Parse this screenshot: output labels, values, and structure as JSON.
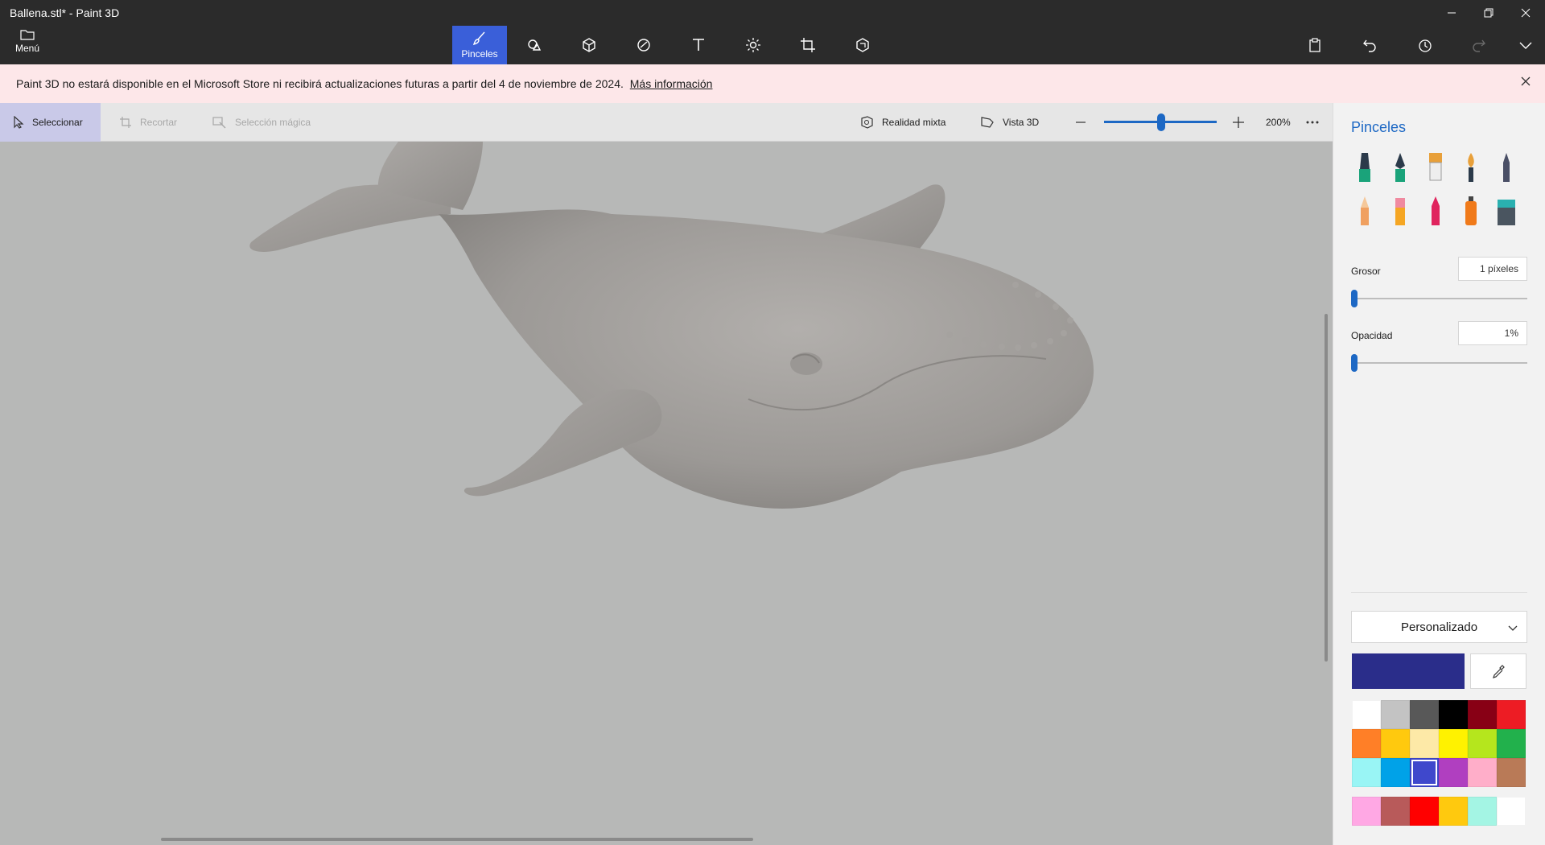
{
  "window": {
    "title": "Ballena.stl* - Paint 3D",
    "menu_label": "Menú"
  },
  "tools": [
    {
      "name": "brushes",
      "label": "Pinceles",
      "icon": "brush-icon",
      "active": true
    },
    {
      "name": "shapes-2d",
      "label": "",
      "icon": "2d-shapes-icon"
    },
    {
      "name": "shapes-3d",
      "label": "",
      "icon": "3d-shapes-icon"
    },
    {
      "name": "stickers",
      "label": "",
      "icon": "stickers-icon"
    },
    {
      "name": "text",
      "label": "",
      "icon": "text-icon"
    },
    {
      "name": "effects",
      "label": "",
      "icon": "effects-icon"
    },
    {
      "name": "canvas",
      "label": "",
      "icon": "canvas-icon"
    },
    {
      "name": "3d-library",
      "label": "",
      "icon": "3d-library-icon"
    }
  ],
  "banner": {
    "text": "Paint 3D no estará disponible en el Microsoft Store ni recibirá actualizaciones futuras a partir del 4 de noviembre de 2024.",
    "link": "Más información"
  },
  "canvas_toolbar": {
    "select": "Seleccionar",
    "crop": "Recortar",
    "magic_select": "Selección mágica",
    "mixed_reality": "Realidad mixta",
    "view3d": "Vista 3D",
    "zoom": "200%"
  },
  "panel": {
    "title": "Pinceles",
    "brushes": [
      {
        "name": "marker",
        "color": "#1aa37a"
      },
      {
        "name": "calligraphy-pen",
        "color": "#1aa37a"
      },
      {
        "name": "oil-brush",
        "color": "#e8a03a"
      },
      {
        "name": "watercolor",
        "color": "#e8a03a"
      },
      {
        "name": "pixel-pen",
        "color": "#4a4f66"
      },
      {
        "name": "pencil",
        "color": "#f0a060"
      },
      {
        "name": "eraser",
        "color": "#f08aa0"
      },
      {
        "name": "crayon",
        "color": "#e0245e"
      },
      {
        "name": "spray-can",
        "color": "#f07a1a"
      },
      {
        "name": "fill",
        "color": "#2ab0b0"
      }
    ],
    "thickness_label": "Grosor",
    "thickness_value": "1 píxeles",
    "thickness_level": 0.01,
    "opacity_label": "Opacidad",
    "opacity_value": "1%",
    "opacity_level": 0.01,
    "dropdown_value": "Personalizado",
    "current_color": "#2a2d8a",
    "palette": [
      "#ffffff",
      "#c3c3c3",
      "#585858",
      "#000000",
      "#880015",
      "#ed1c24",
      "#ff7f27",
      "#ffc90e",
      "#fde9a7",
      "#fff200",
      "#b5e61d",
      "#22b14c",
      "#99f5f5",
      "#00a2e8",
      "#3f48cc",
      "#b03fc0",
      "#ffaec9",
      "#b97a57"
    ],
    "palette_selected_index": 14,
    "custom_palette": [
      "#ffa8e4",
      "#b85a5a",
      "#ff0000",
      "#ffc90e",
      "#a4f5e4",
      "#ffffff"
    ]
  }
}
